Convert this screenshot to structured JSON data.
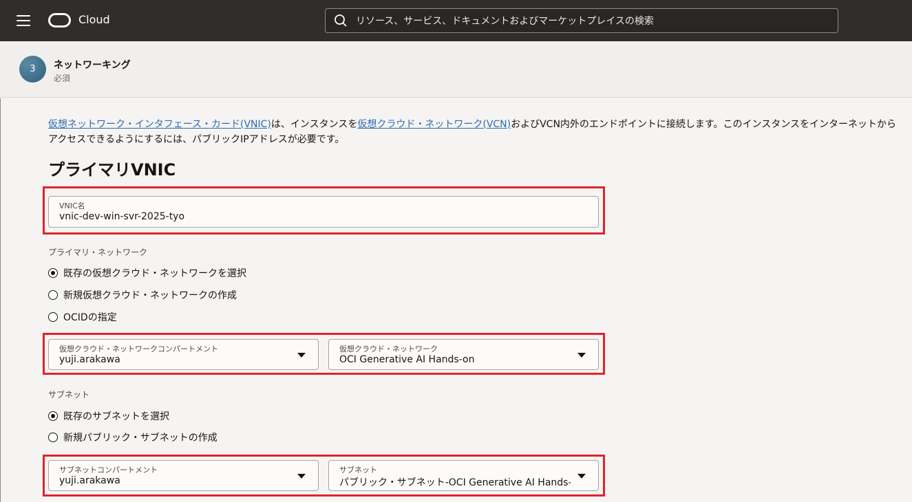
{
  "header": {
    "brand": "Cloud",
    "search_placeholder": "リソース、サービス、ドキュメントおよびマーケットプレイスの検索"
  },
  "step": {
    "number": "3",
    "title": "ネットワーキング",
    "subtitle": "必須"
  },
  "intro": {
    "link1": "仮想ネットワーク・インタフェース・カード(VNIC)",
    "text1": "は、インスタンスを",
    "link2": "仮想クラウド・ネットワーク(VCN)",
    "text2": "およびVCN内外のエンドポイントに接続します。このインスタンスをインターネットからアクセスできるようにするには、パブリックIPアドレスが必要です。"
  },
  "section_title": "プライマリVNIC",
  "vnic_name": {
    "label": "VNIC名",
    "value": "vnic-dev-win-svr-2025-tyo"
  },
  "primary_network": {
    "label": "プライマリ・ネットワーク",
    "options": [
      {
        "label": "既存の仮想クラウド・ネットワークを選択",
        "selected": true
      },
      {
        "label": "新規仮想クラウド・ネットワークの作成",
        "selected": false
      },
      {
        "label": "OCIDの指定",
        "selected": false
      }
    ],
    "compartment": {
      "label": "仮想クラウド・ネットワークコンパートメント",
      "value": "yuji.arakawa"
    },
    "vcn": {
      "label": "仮想クラウド・ネットワーク",
      "value": "OCI Generative AI Hands-on"
    }
  },
  "subnet": {
    "label": "サブネット",
    "options": [
      {
        "label": "既存のサブネットを選択",
        "selected": true
      },
      {
        "label": "新規パブリック・サブネットの作成",
        "selected": false
      }
    ],
    "compartment": {
      "label": "サブネットコンパートメント",
      "value": "yuji.arakawa"
    },
    "subnet": {
      "label": "サブネット",
      "value": "パブリック・サブネット-OCI Generative AI Hands-on"
    }
  },
  "colors": {
    "topbar": "#312d2a",
    "highlight": "#e0232e",
    "link": "#2b6bb3"
  }
}
